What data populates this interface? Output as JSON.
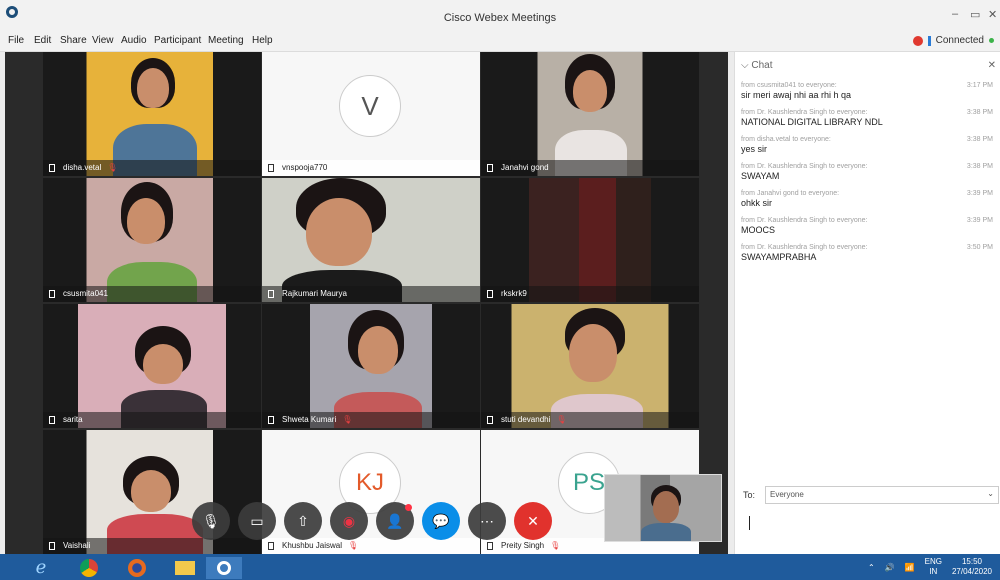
{
  "window": {
    "title": "Cisco Webex Meetings",
    "min": "–",
    "max": "▭",
    "close": "✕"
  },
  "menu": [
    "File",
    "Edit",
    "Share",
    "View",
    "Audio",
    "Participant",
    "Meeting",
    "Help"
  ],
  "status": {
    "connection": "Connected"
  },
  "participants": [
    {
      "name": "disha.vetal",
      "muted": true
    },
    {
      "name": "vnspooja770",
      "muted": false,
      "initials": "V"
    },
    {
      "name": "Janahvi gond",
      "muted": false
    },
    {
      "name": "csusmita041",
      "muted": false
    },
    {
      "name": "Rajkumari Maurya",
      "muted": false
    },
    {
      "name": "rkskrk9",
      "muted": false
    },
    {
      "name": "sarita",
      "muted": false
    },
    {
      "name": "Shweta Kumari",
      "muted": true
    },
    {
      "name": "stuti devandhi",
      "muted": true
    },
    {
      "name": "Vaishali",
      "muted": false
    },
    {
      "name": "Khushbu Jaiswal",
      "muted": true,
      "initials": "KJ"
    },
    {
      "name": "Preity Singh",
      "muted": true,
      "initials": "PS"
    }
  ],
  "chat": {
    "title": "Chat",
    "messages": [
      {
        "from": "from csusmita041 to everyone:",
        "time": "3:17 PM",
        "text": "sir meri awaj nhi aa rhi h qa"
      },
      {
        "from": "from Dr. Kaushlendra Singh to everyone:",
        "time": "3:38 PM",
        "text": "NATIONAL DIGITAL LIBRARY NDL"
      },
      {
        "from": "from disha.vetal to everyone:",
        "time": "3:38 PM",
        "text": "yes sir"
      },
      {
        "from": "from Dr. Kaushlendra Singh to everyone:",
        "time": "3:38 PM",
        "text": "SWAYAM"
      },
      {
        "from": "from Janahvi gond to everyone:",
        "time": "3:39 PM",
        "text": "ohkk sir"
      },
      {
        "from": "from Dr. Kaushlendra Singh to everyone:",
        "time": "3:39 PM",
        "text": "MOOCS"
      },
      {
        "from": "from Dr. Kaushlendra Singh to everyone:",
        "time": "3:50 PM",
        "text": "SWAYAMPRABHA"
      }
    ],
    "to_label": "To:",
    "to_value": "Everyone"
  },
  "controls": [
    {
      "name": "mute-button",
      "icon": "mic-off-icon",
      "glyph": "🎙"
    },
    {
      "name": "video-button",
      "icon": "camera-off-icon",
      "glyph": "▭"
    },
    {
      "name": "share-button",
      "icon": "share-icon",
      "glyph": "⇧"
    },
    {
      "name": "record-button",
      "icon": "record-icon",
      "glyph": "◉"
    },
    {
      "name": "participants-button",
      "icon": "participants-icon",
      "glyph": "👤"
    },
    {
      "name": "chat-button",
      "icon": "chat-icon",
      "glyph": "💬"
    },
    {
      "name": "more-button",
      "icon": "more-icon",
      "glyph": "⋯"
    },
    {
      "name": "end-call-button",
      "icon": "close-icon",
      "glyph": "✕"
    }
  ],
  "taskbar": {
    "lang": "ENG",
    "region": "IN",
    "time": "15:50",
    "date": "27/04/2020"
  }
}
